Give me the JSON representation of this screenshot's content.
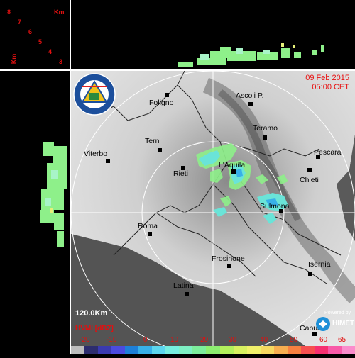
{
  "header": {
    "date": "09 Feb 2015",
    "time": "05:00 CET"
  },
  "range": "120.0Km",
  "product": "HVMI [dBZ]",
  "powered_by": "Powered by",
  "brand": "HIMET",
  "height_axis": {
    "unit": "Km",
    "ticks": [
      "8",
      "7",
      "6",
      "5",
      "4",
      "3"
    ]
  },
  "cities": [
    {
      "name": "Foligno"
    },
    {
      "name": "Ascoli P."
    },
    {
      "name": "Teramo"
    },
    {
      "name": "Terni"
    },
    {
      "name": "Viterbo"
    },
    {
      "name": "L'Aquila"
    },
    {
      "name": "Pescara"
    },
    {
      "name": "Rieti"
    },
    {
      "name": "Chieti"
    },
    {
      "name": "Sulmona"
    },
    {
      "name": "Roma"
    },
    {
      "name": "Frosinone"
    },
    {
      "name": "Isernia"
    },
    {
      "name": "Latina"
    },
    {
      "name": "Capua"
    }
  ],
  "legend": {
    "ticks": [
      "-20",
      "-10",
      "0",
      "10",
      "20",
      "30",
      "40",
      "50",
      "60",
      "65"
    ],
    "colors": [
      "#bdbdbd",
      "#2d2d6e",
      "#3a3ab0",
      "#4b4be0",
      "#1e7fd8",
      "#38b0e8",
      "#5cd6ee",
      "#76eee0",
      "#7ef0c4",
      "#7cee9c",
      "#8cee70",
      "#b4f05c",
      "#d8f060",
      "#f0f06a",
      "#f6d860",
      "#f6ae50",
      "#f68040",
      "#f65050",
      "#f63070",
      "#f85aa8",
      "#fa8ccc"
    ]
  }
}
